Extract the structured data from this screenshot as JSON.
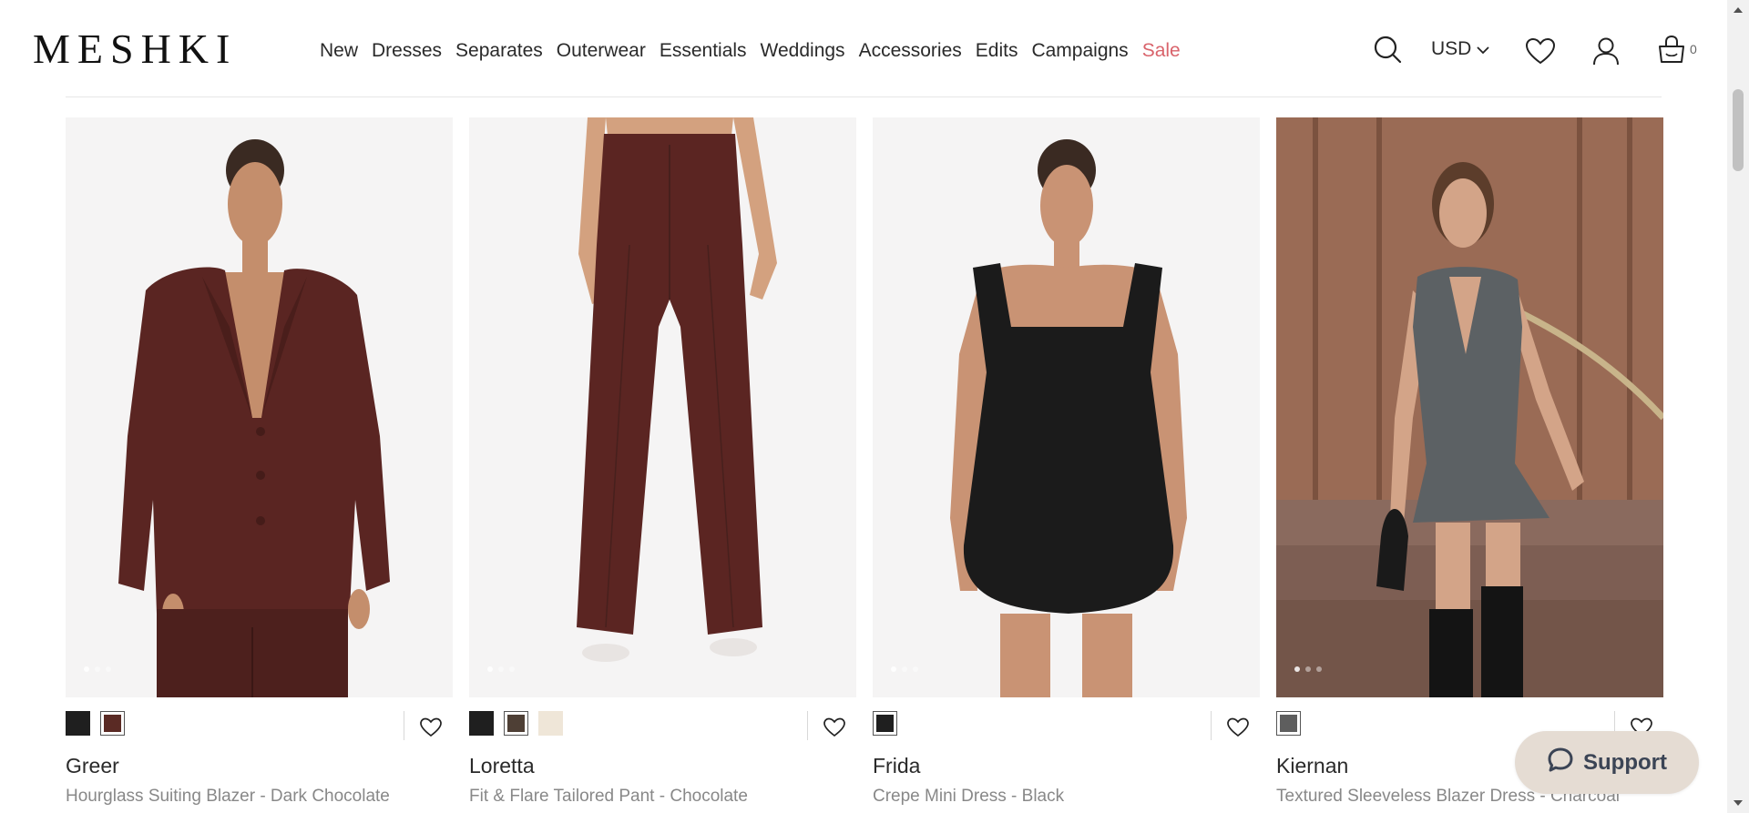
{
  "brand": {
    "logo": "MESHKI"
  },
  "nav": {
    "items": [
      "New",
      "Dresses",
      "Separates",
      "Outerwear",
      "Essentials",
      "Weddings",
      "Accessories",
      "Edits",
      "Campaigns"
    ],
    "sale_label": "Sale",
    "sale_color": "#d9636b"
  },
  "header": {
    "currency": "USD",
    "cart_count": "0",
    "icons": [
      "search-icon",
      "chevron-down-icon",
      "heart-icon",
      "user-icon",
      "cart-icon"
    ]
  },
  "products": [
    {
      "name": "Greer",
      "description": "Hourglass Suiting Blazer - Dark Chocolate",
      "swatches": [
        "#1f1f1f",
        "#5a2a24"
      ],
      "selected_swatch": 1
    },
    {
      "name": "Loretta",
      "description": "Fit & Flare Tailored Pant - Chocolate",
      "swatches": [
        "#1f1f1f",
        "#4e3f35",
        "#efe6d8"
      ],
      "selected_swatch": 1
    },
    {
      "name": "Frida",
      "description": "Crepe Mini Dress - Black",
      "swatches": [
        "#1f1f1f"
      ],
      "selected_swatch": 0
    },
    {
      "name": "Kiernan",
      "description": "Textured Sleeveless Blazer Dress - Charcoal",
      "swatches": [
        "#5e5e5e"
      ],
      "selected_swatch": 0
    }
  ],
  "support": {
    "label": "Support",
    "bg": "#e5dcd3"
  }
}
